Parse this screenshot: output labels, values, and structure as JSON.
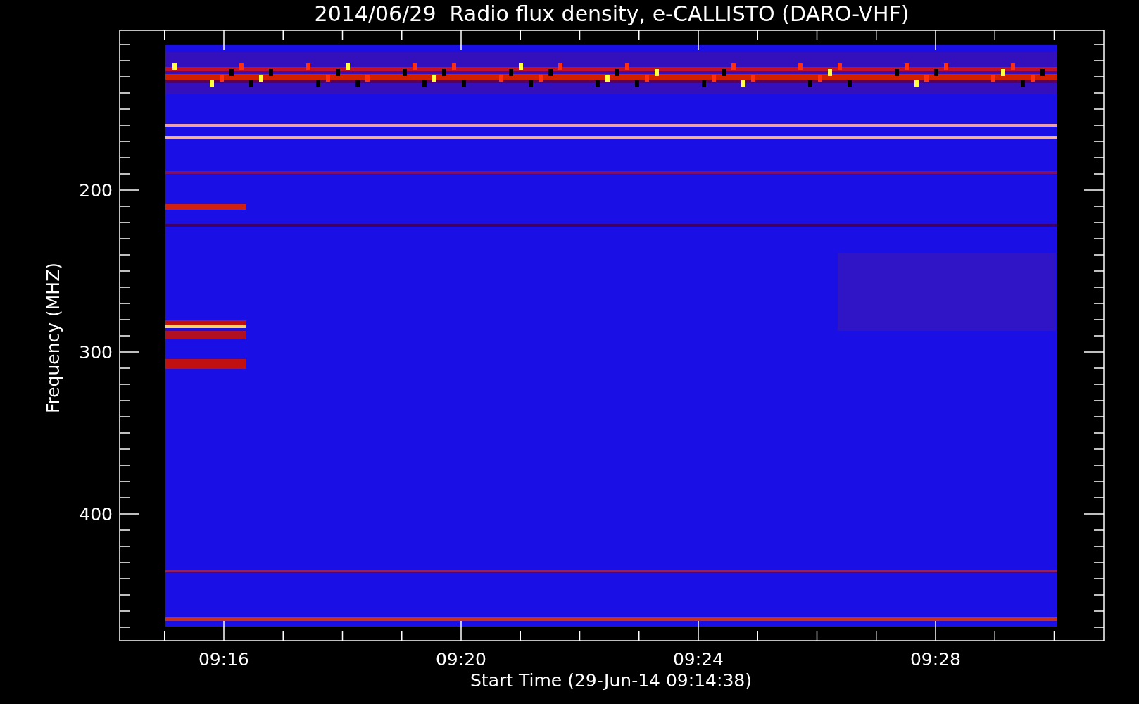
{
  "title": "2014/06/29  Radio flux density, e-CALLISTO (DARO-VHF)",
  "plot": {
    "ylabel": "Frequency (MHZ)",
    "xlabel": "Start Time (29-Jun-14 09:14:38)",
    "yticks": [
      "200",
      "300",
      "400"
    ],
    "xticks": [
      "09:16",
      "09:20",
      "09:24",
      "09:28"
    ]
  }
}
